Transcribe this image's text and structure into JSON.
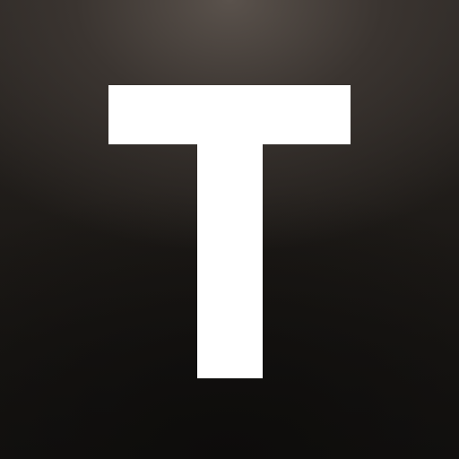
{
  "icon": {
    "letter": "T",
    "name": "t-letter-icon",
    "colors": {
      "glyph": "#ffffff",
      "background_top": "#5a524c",
      "background_mid": "#2b2724",
      "background_bottom": "#141210"
    }
  }
}
